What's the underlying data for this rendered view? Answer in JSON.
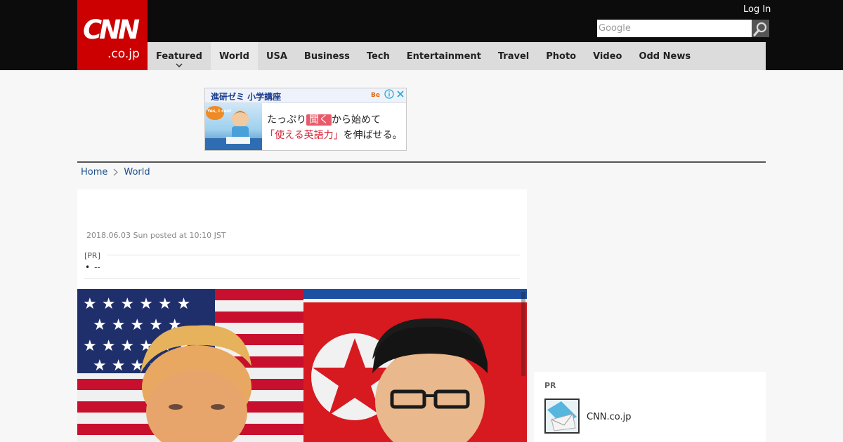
{
  "header": {
    "logo_main": "CNN",
    "logo_sub": ".co.jp",
    "login_label": "Log In",
    "search_placeholder": "Google"
  },
  "nav": {
    "items": [
      {
        "label": "Featured"
      },
      {
        "label": "World"
      },
      {
        "label": "USA"
      },
      {
        "label": "Business"
      },
      {
        "label": "Tech"
      },
      {
        "label": "Entertainment"
      },
      {
        "label": "Travel"
      },
      {
        "label": "Photo"
      },
      {
        "label": "Video"
      },
      {
        "label": "Odd News"
      }
    ],
    "active": "World"
  },
  "ad": {
    "brand": "進研ゼミ 小学講座",
    "line1_a": "たっぷり",
    "line1_hl": "聞く",
    "line1_b": "から始めて",
    "line2_a": "「使える英語力」",
    "line2_b": "を伸ばせる。",
    "kid_bubble": "Yes, I can!"
  },
  "breadcrumb": {
    "home": "Home",
    "section": "World"
  },
  "article": {
    "date": "2018.06.03 Sun posted at 10:10 JST",
    "pr_label": "[PR]",
    "pr_item": "--"
  },
  "sidebar": {
    "pr_title": "PR",
    "pr_link": "CNN.co.jp"
  },
  "colors": {
    "brand_red": "#cc0000",
    "header_bg": "#0c0c0c",
    "nav_bg": "#dcdcdc",
    "link_blue": "#1d4f8a"
  }
}
